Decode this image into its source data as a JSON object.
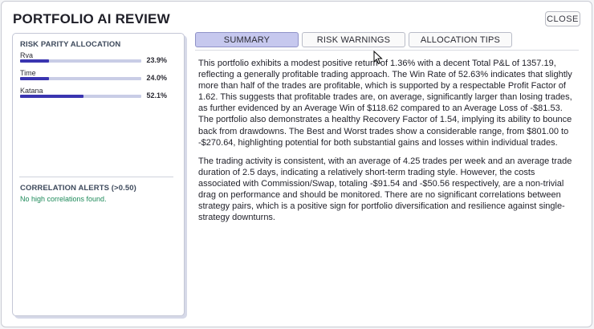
{
  "window": {
    "title": "PORTFOLIO AI REVIEW",
    "close_label": "CLOSE"
  },
  "left_panel": {
    "allocation": {
      "title": "RISK PARITY ALLOCATION",
      "items": [
        {
          "name": "Rva",
          "value": "23.9%",
          "fraction": 0.239
        },
        {
          "name": "Time",
          "value": "24.0%",
          "fraction": 0.24
        },
        {
          "name": "Katana",
          "value": "52.1%",
          "fraction": 0.521
        }
      ]
    },
    "correlation": {
      "title": "CORRELATION ALERTS (>0.50)",
      "message": "No high correlations found."
    }
  },
  "tabs": [
    {
      "label": "SUMMARY",
      "active": true
    },
    {
      "label": "RISK WARNINGS",
      "active": false
    },
    {
      "label": "ALLOCATION TIPS",
      "active": false
    }
  ],
  "content": {
    "paragraphs": [
      "This portfolio exhibits a modest positive return of 1.36% with a decent Total P&L of 1357.19, reflecting a generally profitable trading approach. The Win Rate of 52.63% indicates that slightly more than half of the trades are profitable, which is supported by a respectable Profit Factor of 1.62. This suggests that profitable trades are, on average, significantly larger than losing trades, as further evidenced by an Average Win of $118.62 compared to an Average Loss of -$81.53. The portfolio also demonstrates a healthy Recovery Factor of 1.54, implying its ability to bounce back from drawdowns. The Best and Worst trades show a considerable range, from $801.00 to -$270.64, highlighting potential for both substantial gains and losses within individual trades.",
      "The trading activity is consistent, with an average of 4.25 trades per week and an average trade duration of 2.5 days, indicating a relatively short-term trading style. However, the costs associated with Commission/Swap, totaling -$91.54 and -$50.56 respectively, are a non-trivial drag on performance and should be monitored. There are no significant correlations between strategy pairs, which is a positive sign for portfolio diversification and resilience against single-strategy downturns."
    ]
  },
  "colors": {
    "accent": "#3a35b0",
    "tab_active": "#c6c8ee",
    "alert_ok": "#1e8a5a"
  }
}
